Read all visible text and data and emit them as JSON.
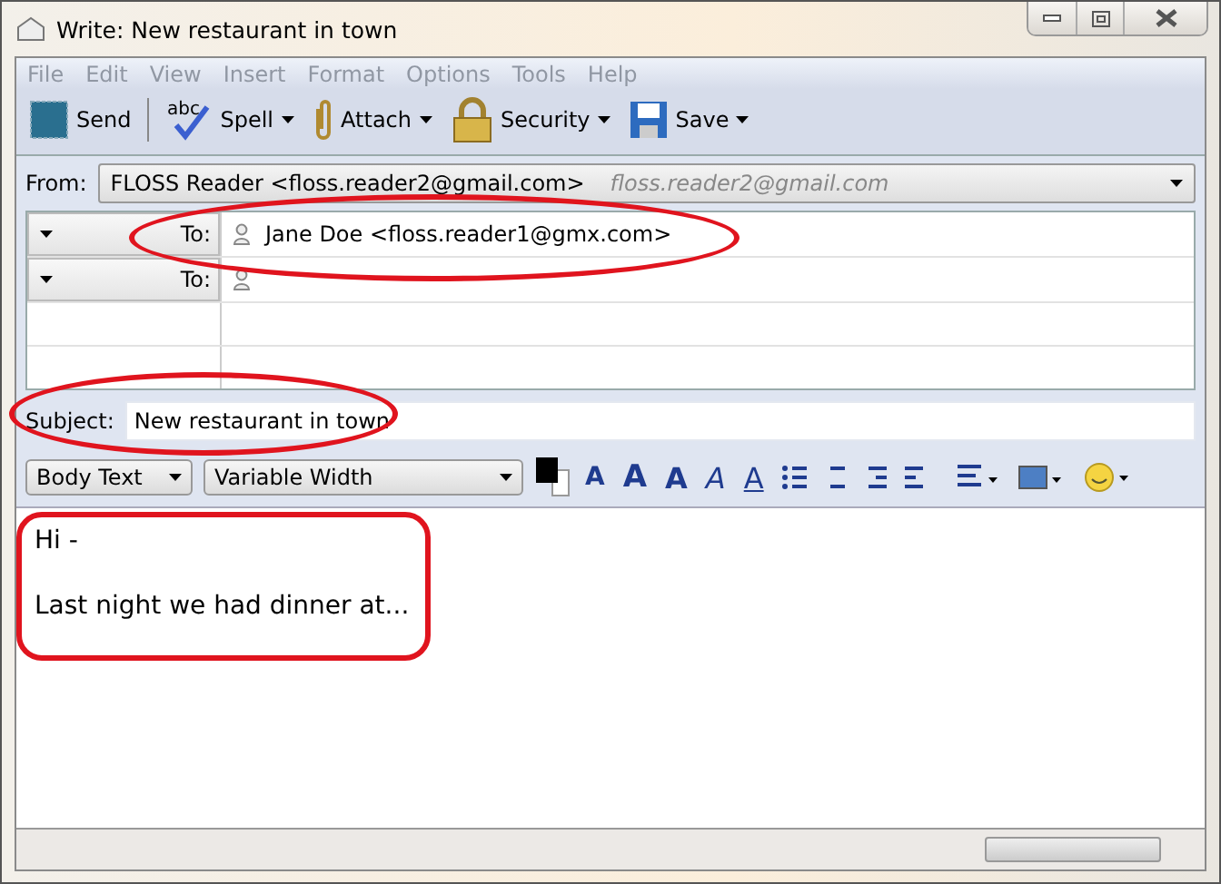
{
  "window": {
    "title": "Write: New restaurant in town"
  },
  "menu": [
    "File",
    "Edit",
    "View",
    "Insert",
    "Format",
    "Options",
    "Tools",
    "Help"
  ],
  "toolbar": [
    {
      "kind": "send",
      "label": "Send",
      "dropdown": false
    },
    {
      "kind": "spell",
      "label": "Spell",
      "dropdown": true,
      "icon_text": "abc"
    },
    {
      "kind": "attach",
      "label": "Attach",
      "dropdown": true
    },
    {
      "kind": "security",
      "label": "Security",
      "dropdown": true
    },
    {
      "kind": "save",
      "label": "Save",
      "dropdown": true
    }
  ],
  "from": {
    "label": "From:",
    "identity": "FLOSS Reader <floss.reader2@gmail.com>",
    "hint": "floss.reader2@gmail.com"
  },
  "recipients": [
    {
      "type": "To:",
      "address": "Jane Doe <floss.reader1@gmx.com>"
    },
    {
      "type": "To:"
    }
  ],
  "subject": {
    "label": "Subject:",
    "value": "New restaurant in town"
  },
  "format": {
    "paragraph": "Body Text",
    "font": "Variable Width",
    "size_glyphs": [
      "A",
      "A"
    ],
    "style_glyphs": [
      "A",
      "A",
      "A"
    ]
  },
  "progress": {
    "level": 0
  },
  "body": [
    "Hi -",
    "Last night we had dinner at..."
  ]
}
